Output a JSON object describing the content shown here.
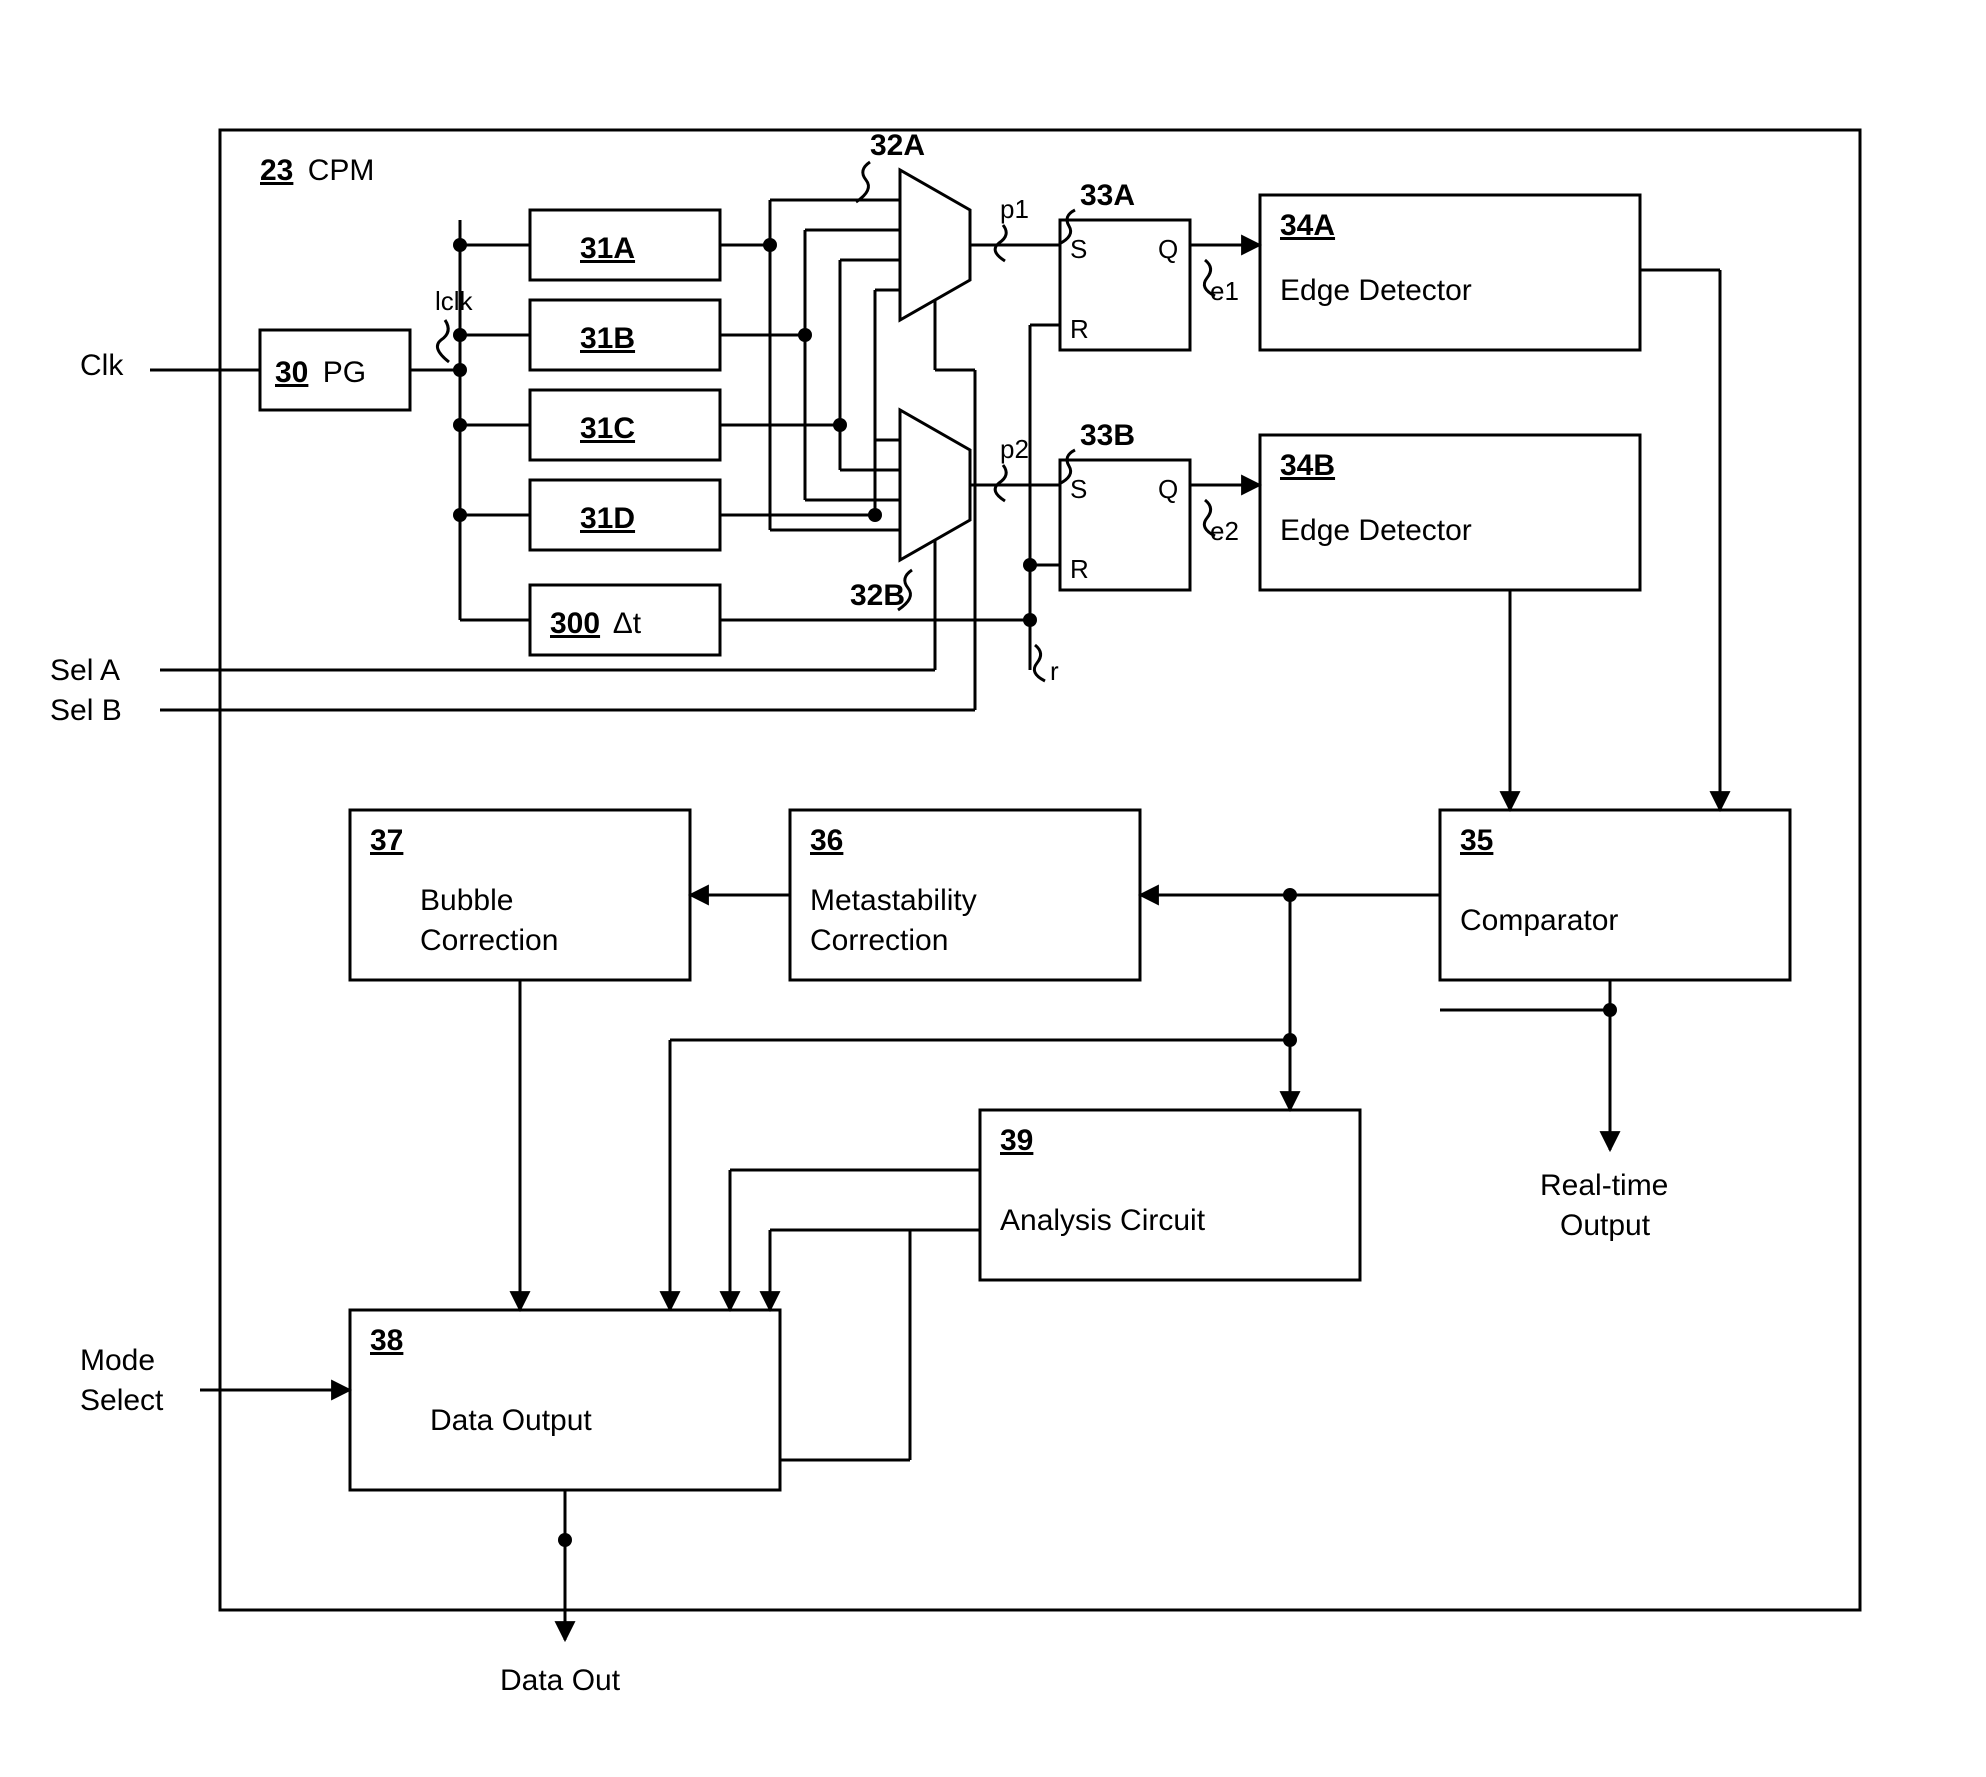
{
  "main": {
    "ref": "23",
    "label": "CPM"
  },
  "inputs": {
    "clk": "Clk",
    "selA": "Sel A",
    "selB": "Sel B",
    "mode": {
      "l1": "Mode",
      "l2": "Select"
    }
  },
  "outputs": {
    "rt": {
      "l1": "Real-time",
      "l2": "Output"
    },
    "data": "Data Out"
  },
  "signals": {
    "lclk": "lclk",
    "p1": "p1",
    "p2": "p2",
    "e1": "e1",
    "e2": "e2",
    "r": "r"
  },
  "blocks": {
    "pg": {
      "ref": "30",
      "label": "PG"
    },
    "d31A": {
      "ref": "31A"
    },
    "d31B": {
      "ref": "31B"
    },
    "d31C": {
      "ref": "31C"
    },
    "d31D": {
      "ref": "31D"
    },
    "dt": {
      "ref": "300",
      "label": "Δt"
    },
    "muxA": {
      "ref": "32A"
    },
    "muxB": {
      "ref": "32B"
    },
    "latA": {
      "ref": "33A",
      "s": "S",
      "r": "R",
      "q": "Q"
    },
    "latB": {
      "ref": "33B",
      "s": "S",
      "r": "R",
      "q": "Q"
    },
    "edA": {
      "ref": "34A",
      "label": "Edge Detector"
    },
    "edB": {
      "ref": "34B",
      "label": "Edge Detector"
    },
    "cmp": {
      "ref": "35",
      "label": "Comparator"
    },
    "meta": {
      "ref": "36",
      "l1": "Metastability",
      "l2": "Correction"
    },
    "bub": {
      "ref": "37",
      "l1": "Bubble",
      "l2": "Correction"
    },
    "dout": {
      "ref": "38",
      "label": "Data Output"
    },
    "ana": {
      "ref": "39",
      "label": "Analysis Circuit"
    }
  }
}
